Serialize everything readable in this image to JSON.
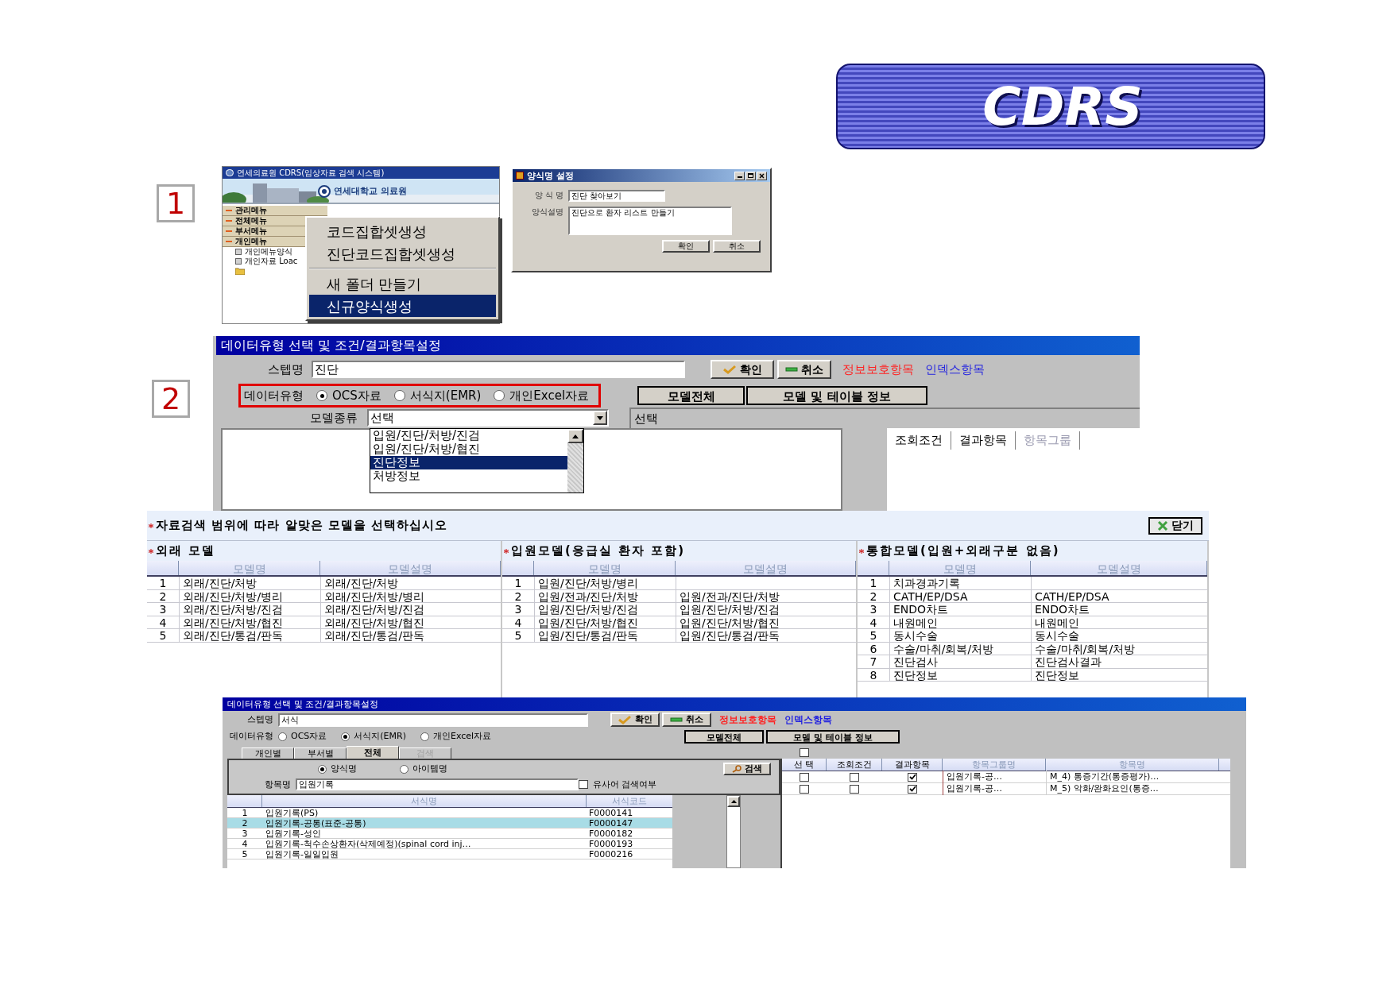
{
  "banner": {
    "title": "CDRS"
  },
  "step_one": {
    "number": "1",
    "app_window": {
      "title": "연세의료원 CDRS(임상자료 검색 시스템)",
      "logo_text": "연세대학교 의료원",
      "menu_groups": [
        "관리메뉴",
        "전체메뉴",
        "부서메뉴",
        "개인메뉴"
      ],
      "tree_items": [
        {
          "label": "개인메뉴양식",
          "selected": false
        },
        {
          "label": "개인자료 Loac",
          "selected": false
        }
      ]
    },
    "context_menu": [
      {
        "kind": "item",
        "label": "코드집합셋생성",
        "selected": false
      },
      {
        "kind": "item",
        "label": "진단코드집합셋생성",
        "selected": false
      },
      {
        "kind": "separator"
      },
      {
        "kind": "item",
        "label": "새 폴더 만들기",
        "selected": false
      },
      {
        "kind": "item",
        "label": "신규양식생성",
        "selected": true
      }
    ],
    "dialog": {
      "title": "양식명 설정",
      "fields": [
        {
          "kind": "line",
          "label": "양 식 명",
          "value": "진단 찾아보기"
        },
        {
          "kind": "area",
          "label": "양식설명",
          "value": "진단으로 환자 리스트 만들기"
        }
      ],
      "buttons": [
        "확인",
        "취소"
      ]
    }
  },
  "step_two": {
    "number": "2",
    "window": {
      "title": "데이터유형 선택 및 조건/결과항목설정",
      "step_label": "스텝명",
      "step_value": "진단",
      "confirm_button": "확인",
      "cancel_button": "취소",
      "legend": [
        {
          "label": "정보보호항목",
          "color": "#ff2020"
        },
        {
          "label": "인덱스항목",
          "color": "#1f1fe0"
        }
      ],
      "data_type_label": "데이터유형",
      "data_type_highlighted": true,
      "data_types": [
        {
          "label": "OCS자료",
          "selected": true
        },
        {
          "label": "서식지(EMR)",
          "selected": false
        },
        {
          "label": "개인Excel자료",
          "selected": false
        }
      ],
      "model_buttons": [
        "모델전체",
        "모델 및 테이블 정보"
      ],
      "model_type_label": "모델종류",
      "model_type_value": "선택",
      "model_options": [
        {
          "label": "입원/진단/처방/진검",
          "selected": false
        },
        {
          "label": "입원/진단/처방/협진",
          "selected": false
        },
        {
          "label": "진단정보",
          "selected": true
        },
        {
          "label": "처방정보",
          "selected": false
        }
      ],
      "selection_label": "선택",
      "columns": [
        {
          "label": "조회조건",
          "disabled": false
        },
        {
          "label": "결과항목",
          "disabled": false
        },
        {
          "label": "항목그룹",
          "disabled": true
        }
      ]
    }
  },
  "model_picker": {
    "instruction": "자료검색 범위에 따라 알맞은 모델을 선택하십시오",
    "close_button": "닫기",
    "groups": [
      {
        "title": "외래 모델",
        "columns": [
          "모델명",
          "모델설명"
        ],
        "rows": [
          {
            "no": "1",
            "name": "외래/진단/처방",
            "description": "외래/진단/처방"
          },
          {
            "no": "2",
            "name": "외래/진단/처방/병리",
            "description": "외래/진단/처방/병리"
          },
          {
            "no": "3",
            "name": "외래/진단/처방/진검",
            "description": "외래/진단/처방/진검"
          },
          {
            "no": "4",
            "name": "외래/진단/처방/협진",
            "description": "외래/진단/처방/협진"
          },
          {
            "no": "5",
            "name": "외래/진단/통검/판독",
            "description": "외래/진단/통검/판독"
          }
        ]
      },
      {
        "title": "입원모델(응급실 환자 포함)",
        "columns": [
          "모델명",
          "모델설명"
        ],
        "rows": [
          {
            "no": "1",
            "name": "입원/진단/처방/병리"
          },
          {
            "no": "2",
            "name": "입원/전과/진단/처방",
            "description": "입원/전과/진단/처방"
          },
          {
            "no": "3",
            "name": "입원/진단/처방/진검",
            "description": "입원/진단/처방/진검"
          },
          {
            "no": "4",
            "name": "입원/진단/처방/협진",
            "description": "입원/진단/처방/협진"
          },
          {
            "no": "5",
            "name": "입원/진단/통검/판독",
            "description": "입원/진단/통검/판독"
          }
        ]
      },
      {
        "title": "통합모델(입원+외래구분 없음)",
        "columns": [
          "모델명",
          "모델설명"
        ],
        "rows": [
          {
            "no": "1",
            "name": "치과경과기록"
          },
          {
            "no": "2",
            "name": "CATH/EP/DSA",
            "description": "CATH/EP/DSA"
          },
          {
            "no": "3",
            "name": "ENDO차트",
            "description": "ENDO차트"
          },
          {
            "no": "4",
            "name": "내원메인",
            "description": "내원메인"
          },
          {
            "no": "5",
            "name": "동시수술",
            "description": "동시수술"
          },
          {
            "no": "6",
            "name": "수술/마취/회복/처방",
            "description": "수술/마취/회복/처방"
          },
          {
            "no": "7",
            "name": "진단검사",
            "description": "진단검사결과"
          },
          {
            "no": "8",
            "name": "진단정보",
            "description": "진단정보"
          }
        ]
      }
    ]
  },
  "bottom_window": {
    "title": "데이터유형 선택 및 조건/결과항목설정",
    "step_label": "스텝명",
    "step_value": "서식",
    "confirm_button": "확인",
    "cancel_button": "취소",
    "legend": [
      {
        "label": "정보보호항목",
        "color": "#ff2020"
      },
      {
        "label": "인덱스항목",
        "color": "#1f1fe0"
      }
    ],
    "data_type_label": "데이터유형",
    "data_types": [
      {
        "label": "OCS자료",
        "selected": false
      },
      {
        "label": "서식지(EMR)",
        "selected": true
      },
      {
        "label": "개인Excel자료",
        "selected": false
      }
    ],
    "model_buttons": [
      "모델전체",
      "모델 및 테이블 정보"
    ],
    "tabs": [
      {
        "label": "개인별",
        "selected": false,
        "disabled": false
      },
      {
        "label": "부서별",
        "selected": false,
        "disabled": false
      },
      {
        "label": "전체",
        "selected": true,
        "disabled": false
      },
      {
        "label": "검색",
        "selected": false,
        "disabled": true
      }
    ],
    "search_modes": [
      {
        "label": "양식명",
        "selected": true
      },
      {
        "label": "아이템명",
        "selected": false
      }
    ],
    "search_button": "검색",
    "item_label": "항목명",
    "item_value": "입원기록",
    "similar_word": {
      "label": "유사어 검색여부",
      "checked": false
    },
    "form_columns": [
      "서식명",
      "서식코드"
    ],
    "forms": [
      {
        "no": "1",
        "name": "입원기록(PS)",
        "code": "F0000141",
        "selected": false
      },
      {
        "no": "2",
        "name": "입원기록-공통(표준-공통)",
        "code": "F0000147",
        "selected": true
      },
      {
        "no": "3",
        "name": "입원기록-성인",
        "code": "F0000182",
        "selected": false
      },
      {
        "no": "4",
        "name": "입원기록-척수손상환자(삭제예정)(spinal cord inj…",
        "code": "F0000193",
        "selected": false
      },
      {
        "no": "5",
        "name": "입원기록-일일입원",
        "code": "F0000216",
        "selected": false
      }
    ],
    "select_all_checked": false,
    "result_columns": [
      {
        "label": "선 택",
        "disabled": false
      },
      {
        "label": "조회조건",
        "disabled": false
      },
      {
        "label": "결과항목",
        "disabled": false
      },
      {
        "label": "항목그룹명",
        "disabled": true
      },
      {
        "label": "항목명",
        "disabled": true
      }
    ],
    "results": [
      {
        "selected": false,
        "condition": false,
        "result": true,
        "group": "입원기록-공…",
        "item": "M_4) 통증기간(통증평가)…"
      },
      {
        "selected": false,
        "condition": false,
        "result": true,
        "group": "입원기록-공…",
        "item": "M_5) 악화/완화요인(통증…"
      }
    ]
  }
}
